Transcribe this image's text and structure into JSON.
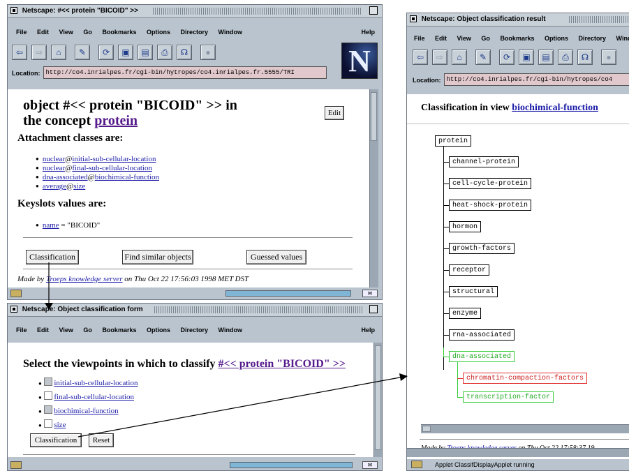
{
  "window1": {
    "title": "Netscape: #<< protein \"BICOID\" >>",
    "menu": [
      "File",
      "Edit",
      "View",
      "Go",
      "Bookmarks",
      "Options",
      "Directory",
      "Window"
    ],
    "menu_help": "Help",
    "location_label": "Location:",
    "location_value": "http://co4.inrialpes.fr/cgi-bin/hytropes/co4.inrialpes.fr.5555/TRI",
    "logo_letter": "N",
    "heading_line1": "object #<< protein \"BICOID\" >> in",
    "heading_line2_prefix": "the concept ",
    "heading_concept_link": "protein",
    "edit_button": "Edit",
    "attachment_heading": "Attachment classes are:",
    "attachments": [
      {
        "a": "nuclear",
        "b": "initial-sub-cellular-location"
      },
      {
        "a": "nuclear",
        "b": "final-sub-cellular-location"
      },
      {
        "a": "dna-associated",
        "b": "biochimical-function"
      },
      {
        "a": "average",
        "b": "size"
      }
    ],
    "keyslots_heading": "Keyslots values are:",
    "keyslot": {
      "name": "name",
      "value": " = \"BICOID\""
    },
    "buttons": {
      "classification": "Classification",
      "find_similar": "Find similar objects",
      "guessed": "Guessed values"
    },
    "footer_prefix": "Made by ",
    "footer_link": "Troeps knowledge server",
    "footer_suffix": " on Thu Oct 22 17:56:03 1998 MET DST"
  },
  "window2": {
    "title": "Netscape: Object classification form",
    "menu": [
      "File",
      "Edit",
      "View",
      "Go",
      "Bookmarks",
      "Options",
      "Directory",
      "Window"
    ],
    "menu_help": "Help",
    "heading_prefix": "Select the viewpoints in which to classify ",
    "heading_link": "#<< protein \"BICOID\" >>",
    "viewpoints": [
      {
        "label": "initial-sub-cellular-location",
        "checked": false
      },
      {
        "label": "final-sub-cellular-location",
        "checked": false
      },
      {
        "label": "biochimical-function",
        "checked": false
      },
      {
        "label": "size",
        "checked": false
      }
    ],
    "classification_button": "Classification",
    "reset_button": "Reset"
  },
  "window3": {
    "title": "Netscape: Object classification result",
    "menu": [
      "File",
      "Edit",
      "View",
      "Go",
      "Bookmarks",
      "Options",
      "Directory",
      "Window"
    ],
    "location_label": "Location:",
    "location_value": "http://co4.inrialpes.fr/cgi-bin/hytropes/co4",
    "heading_prefix": "Classification in view ",
    "heading_link": "biochimical-function",
    "tree_root": "protein",
    "tree_children": [
      "channel-protein",
      "cell-cycle-protein",
      "heat-shock-protein",
      "hormon",
      "growth-factors",
      "receptor",
      "structural",
      "enzyme",
      "rna-associated",
      "dna-associated"
    ],
    "tree_grandchildren": [
      "chromatin-compaction-factors",
      "transcription-factor"
    ],
    "highlight_colors": {
      "matched": "#22aa22",
      "rejected": "#cc2020"
    },
    "footer_prefix": "Made by ",
    "footer_link": "Troeps knowledge server",
    "footer_suffix": " on Thu Oct 22 17:58:37 19",
    "status_text": "Applet ClassifDisplayApplet running"
  },
  "icons": [
    "back-icon",
    "forward-icon",
    "home-icon",
    "edit-icon",
    "reload-icon",
    "images-icon",
    "open-icon",
    "print-icon",
    "find-icon",
    "stop-icon",
    "mail-icon",
    "security-key-icon"
  ]
}
